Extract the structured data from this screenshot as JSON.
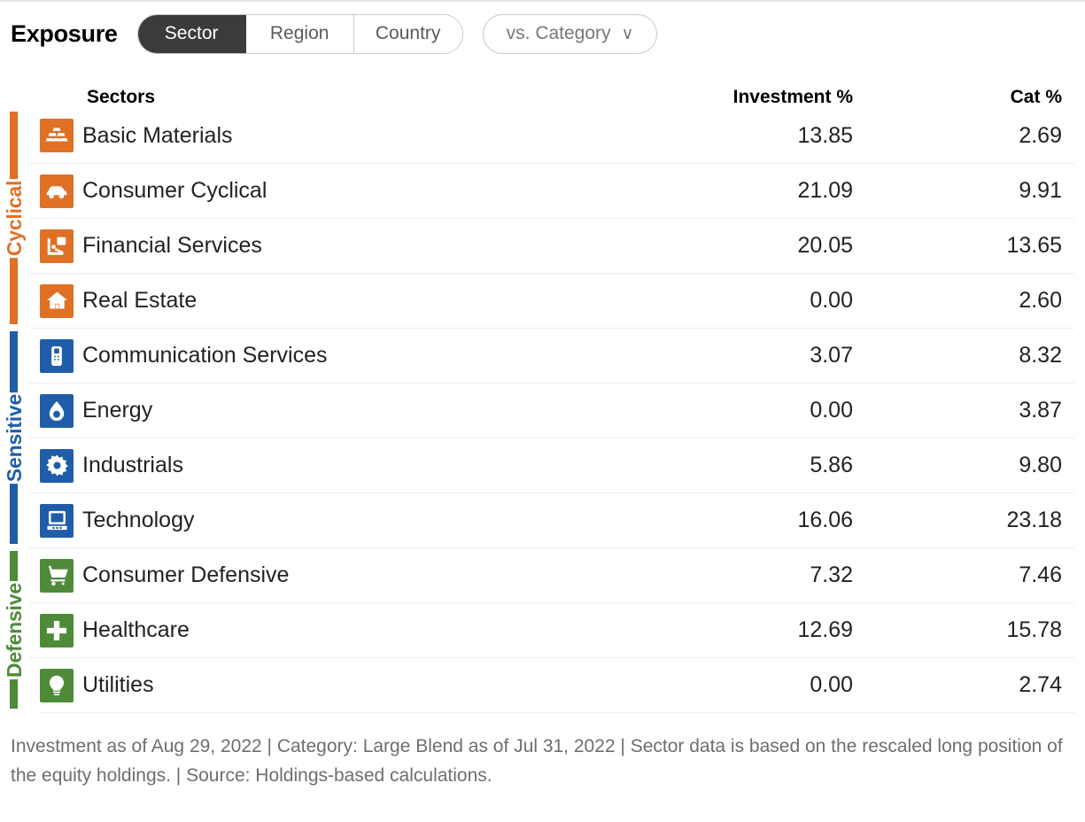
{
  "header": {
    "title": "Exposure",
    "segments": [
      {
        "label": "Sector",
        "active": true
      },
      {
        "label": "Region",
        "active": false
      },
      {
        "label": "Country",
        "active": false
      }
    ],
    "dropdown": {
      "label": "vs. Category",
      "chevron": "∨"
    }
  },
  "table": {
    "columns": {
      "sectors": "Sectors",
      "investment": "Investment  %",
      "category": "Cat  %"
    },
    "groups": [
      {
        "name": "Cyclical",
        "color": "#DF7026",
        "rows": [
          {
            "icon": "basic-materials-icon",
            "name": "Basic Materials",
            "investment": "13.85",
            "category": "2.69"
          },
          {
            "icon": "consumer-cyclical-icon",
            "name": "Consumer Cyclical",
            "investment": "21.09",
            "category": "9.91"
          },
          {
            "icon": "financial-services-icon",
            "name": "Financial Services",
            "investment": "20.05",
            "category": "13.65"
          },
          {
            "icon": "real-estate-icon",
            "name": "Real Estate",
            "investment": "0.00",
            "category": "2.60"
          }
        ]
      },
      {
        "name": "Sensitive",
        "color": "#1F5DA8",
        "rows": [
          {
            "icon": "communication-services-icon",
            "name": "Communication Services",
            "investment": "3.07",
            "category": "8.32"
          },
          {
            "icon": "energy-icon",
            "name": "Energy",
            "investment": "0.00",
            "category": "3.87"
          },
          {
            "icon": "industrials-icon",
            "name": "Industrials",
            "investment": "5.86",
            "category": "9.80"
          },
          {
            "icon": "technology-icon",
            "name": "Technology",
            "investment": "16.06",
            "category": "23.18"
          }
        ]
      },
      {
        "name": "Defensive",
        "color": "#4E8B38",
        "rows": [
          {
            "icon": "consumer-defensive-icon",
            "name": "Consumer Defensive",
            "investment": "7.32",
            "category": "7.46"
          },
          {
            "icon": "healthcare-icon",
            "name": "Healthcare",
            "investment": "12.69",
            "category": "15.78"
          },
          {
            "icon": "utilities-icon",
            "name": "Utilities",
            "investment": "0.00",
            "category": "2.74"
          }
        ]
      }
    ]
  },
  "footnote": "Investment as of Aug 29, 2022 | Category: Large Blend as of Jul 31, 2022 | Sector data is based on the rescaled long position of the equity holdings. | Source: Holdings-based calculations."
}
